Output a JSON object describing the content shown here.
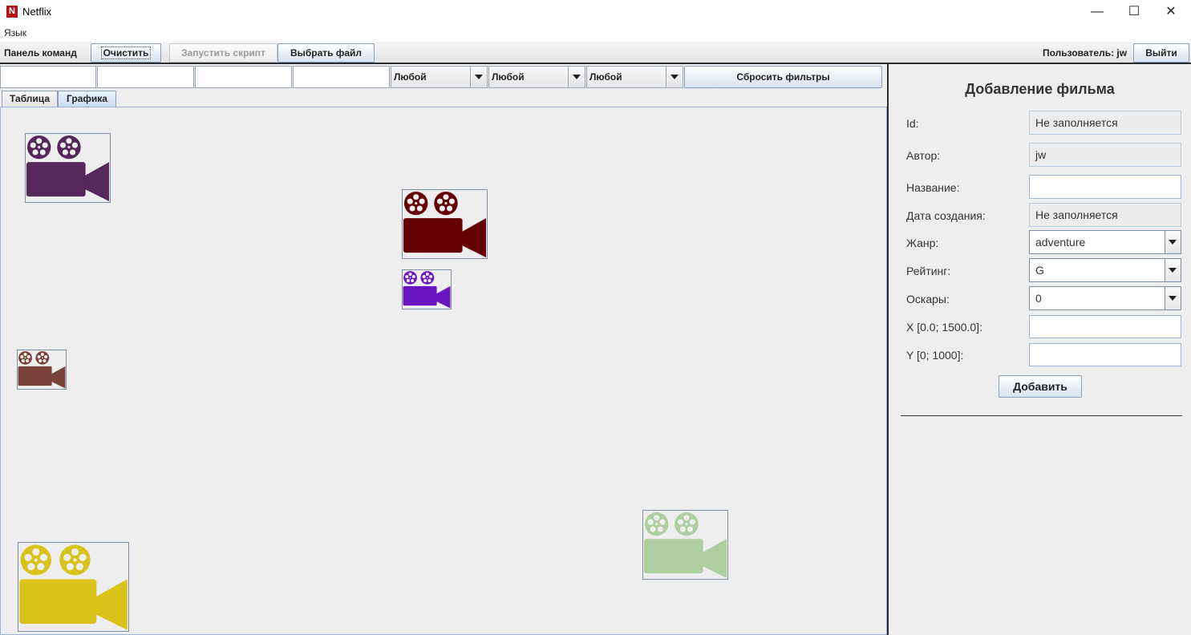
{
  "window": {
    "title": "Netflix",
    "icon_letter": "N",
    "icons": [
      "minimize-icon",
      "maximize-icon",
      "close-icon"
    ],
    "minimize_glyph": "—",
    "maximize_glyph": "☐",
    "close_glyph": "✕"
  },
  "menu": {
    "language": "Язык"
  },
  "command_bar": {
    "label": "Панель команд",
    "clear_button": "Очистить",
    "run_script_button": "Запустить скрипт",
    "choose_file_button": "Выбрать файл",
    "user_label": "Пользователь: jw",
    "logout_button": "Выйти"
  },
  "filters": {
    "text_inputs": [
      "",
      "",
      "",
      ""
    ],
    "combos": [
      "Любой",
      "Любой",
      "Любой"
    ],
    "reset_button": "Сбросить фильтры"
  },
  "tabs": [
    {
      "label": "Таблица",
      "active": false
    },
    {
      "label": "Графика",
      "active": true
    }
  ],
  "films": [
    {
      "color": "#55275a"
    },
    {
      "color": "#640000"
    },
    {
      "color": "#6a14c2"
    },
    {
      "color": "#7a4238"
    },
    {
      "color": "#d9c21a"
    },
    {
      "color": "#aecea0"
    }
  ],
  "form": {
    "title": "Добавление фильма",
    "id_label": "Id:",
    "id_value": "Не заполняется",
    "author_label": "Автор:",
    "author_value": "jw",
    "name_label": "Название:",
    "name_value": "",
    "date_label": "Дата создания:",
    "date_value": "Не заполняется",
    "genre_label": "Жанр:",
    "genre_value": "adventure",
    "rating_label": "Рейтинг:",
    "rating_value": "G",
    "oscars_label": "Оскары:",
    "oscars_value": "0",
    "x_label": "X [0.0; 1500.0]:",
    "x_value": "",
    "y_label": "Y [0; 1000]:",
    "y_value": "",
    "add_button": "Добавить"
  }
}
